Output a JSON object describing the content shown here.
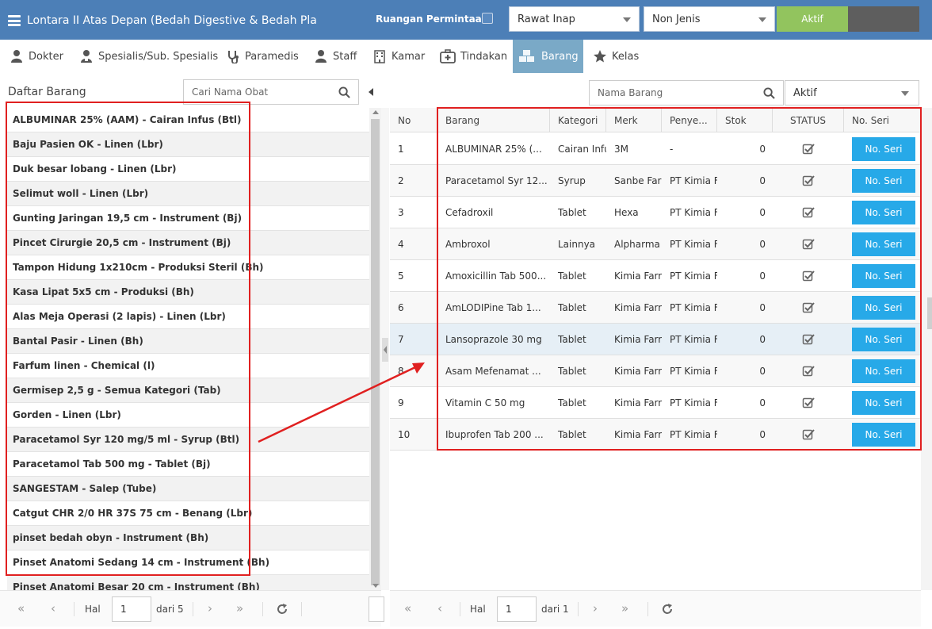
{
  "header": {
    "title": "Lontara II Atas Depan (Bedah Digestive & Bedah Pla",
    "ruangan_label": "Ruangan Permintaan",
    "select_rawat": "Rawat Inap",
    "select_jenis": "Non Jenis",
    "aktif_button": "Aktif"
  },
  "tabs": [
    {
      "label": "Dokter",
      "icon": "user-md-icon"
    },
    {
      "label": "Spesialis/Sub. Spesialis",
      "icon": "user-doctor-icon"
    },
    {
      "label": "Paramedis",
      "icon": "stethoscope-icon"
    },
    {
      "label": "Staff",
      "icon": "user-icon"
    },
    {
      "label": "Kamar",
      "icon": "building-icon"
    },
    {
      "label": "Tindakan",
      "icon": "medkit-icon"
    },
    {
      "label": "Barang",
      "icon": "cubes-icon",
      "active": true
    },
    {
      "label": "Kelas",
      "icon": "star-icon"
    }
  ],
  "left": {
    "title": "Daftar Barang",
    "search_placeholder": "Cari Nama Obat",
    "items": [
      "ALBUMINAR 25% (AAM) - Cairan Infus (Btl)",
      "Baju Pasien OK - Linen (Lbr)",
      "Duk besar lobang - Linen (Lbr)",
      "Selimut woll - Linen (Lbr)",
      "Gunting Jaringan 19,5 cm - Instrument (Bj)",
      "Pincet Cirurgie 20,5 cm - Instrument (Bj)",
      "Tampon Hidung 1x210cm - Produksi Steril (Bh)",
      "Kasa Lipat 5x5 cm - Produksi (Bh)",
      "Alas Meja Operasi (2 lapis) - Linen (Lbr)",
      "Bantal Pasir - Linen (Bh)",
      "Farfum linen - Chemical (l)",
      "Germisep 2,5 g - Semua Kategori (Tab)",
      "Gorden - Linen (Lbr)",
      "Paracetamol Syr 120 mg/5 ml - Syrup (Btl)",
      "Paracetamol Tab 500 mg - Tablet (Bj)",
      "SANGESTAM - Salep (Tube)",
      "Catgut CHR 2/0 HR 37S 75 cm - Benang (Lbr)",
      "pinset bedah obyn - Instrument (Bh)",
      "Pinset Anatomi Sedang 14 cm - Instrument (Bh)",
      "Pinset Anatomi Besar 20 cm - Instrument (Bh)"
    ],
    "pager": {
      "hal_label": "Hal",
      "page": "1",
      "of_label": "dari 5"
    }
  },
  "right": {
    "search_placeholder": "Nama Barang",
    "status_select": "Aktif",
    "columns": [
      "No",
      "Barang",
      "Kategori",
      "Merk",
      "Penye...",
      "Stok",
      "STATUS",
      "No. Seri"
    ],
    "rows": [
      {
        "no": "1",
        "barang": "ALBUMINAR 25% (...",
        "kategori": "Cairan Infus",
        "merk": "3M",
        "penyedia": "-",
        "stok": "0",
        "status": true,
        "seri": "No. Seri"
      },
      {
        "no": "2",
        "barang": "Paracetamol Syr 12...",
        "kategori": "Syrup",
        "merk": "Sanbe Farma",
        "penyedia": "PT Kimia Farma",
        "stok": "0",
        "status": true,
        "seri": "No. Seri"
      },
      {
        "no": "3",
        "barang": "Cefadroxil",
        "kategori": "Tablet",
        "merk": "Hexa",
        "penyedia": "PT Kimia Farma",
        "stok": "0",
        "status": true,
        "seri": "No. Seri"
      },
      {
        "no": "4",
        "barang": "Ambroxol",
        "kategori": "Lainnya",
        "merk": "Alpharma",
        "penyedia": "PT Kimia Farma",
        "stok": "0",
        "status": true,
        "seri": "No. Seri"
      },
      {
        "no": "5",
        "barang": "Amoxicillin Tab 500...",
        "kategori": "Tablet",
        "merk": "Kimia Farma",
        "penyedia": "PT Kimia Farma",
        "stok": "0",
        "status": true,
        "seri": "No. Seri"
      },
      {
        "no": "6",
        "barang": "AmLODIPine Tab 1...",
        "kategori": "Tablet",
        "merk": "Kimia Farma",
        "penyedia": "PT Kimia Farma",
        "stok": "0",
        "status": true,
        "seri": "No. Seri"
      },
      {
        "no": "7",
        "barang": "Lansoprazole 30 mg",
        "kategori": "Tablet",
        "merk": "Kimia Farma",
        "penyedia": "PT Kimia Farma",
        "stok": "0",
        "status": true,
        "seri": "No. Seri",
        "highlight": true
      },
      {
        "no": "8",
        "barang": "Asam Mefenamat ...",
        "kategori": "Tablet",
        "merk": "Kimia Farma",
        "penyedia": "PT Kimia Farma",
        "stok": "0",
        "status": true,
        "seri": "No. Seri"
      },
      {
        "no": "9",
        "barang": "Vitamin C 50 mg",
        "kategori": "Tablet",
        "merk": "Kimia Farma",
        "penyedia": "PT Kimia Farma",
        "stok": "0",
        "status": true,
        "seri": "No. Seri"
      },
      {
        "no": "10",
        "barang": "Ibuprofen Tab 200 ...",
        "kategori": "Tablet",
        "merk": "Kimia Farma",
        "penyedia": "PT Kimia Farma",
        "stok": "0",
        "status": true,
        "seri": "No. Seri"
      }
    ],
    "pager": {
      "hal_label": "Hal",
      "page": "1",
      "of_label": "dari 1"
    }
  },
  "colors": {
    "header": "#4c7fb7",
    "active_tab": "#7aa9c7",
    "seri_button": "#27a9e8",
    "aktif_button": "#92c45e",
    "annotation": "#e02020"
  }
}
